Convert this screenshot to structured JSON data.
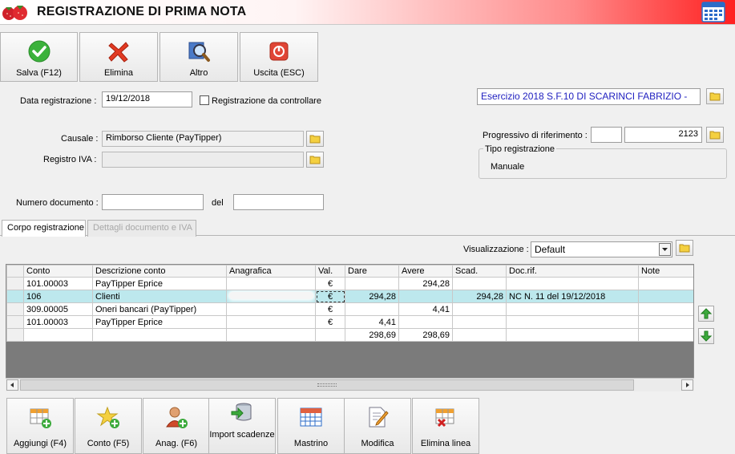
{
  "window": {
    "title": "REGISTRAZIONE DI PRIMA NOTA"
  },
  "toolbar": {
    "save": "Salva (F12)",
    "delete": "Elimina",
    "other": "Altro",
    "exit": "Uscita (ESC)"
  },
  "form": {
    "date_label": "Data registrazione :",
    "date_value": "19/12/2018",
    "check_label": "Registrazione da controllare",
    "causale_label": "Causale :",
    "causale_value": "Rimborso Cliente (PayTipper)",
    "registro_label": "Registro IVA :",
    "registro_value": "",
    "numdoc_label": "Numero documento :",
    "numdoc_value": "",
    "del_label": "del",
    "del_value": ""
  },
  "right_panel": {
    "esercizio": "Esercizio 2018 S.F.10 DI SCARINCI FABRIZIO -",
    "progressivo_label": "Progressivo di riferimento :",
    "progressivo_prefix": "",
    "progressivo_value": "2123",
    "tipo_title": "Tipo registrazione",
    "tipo_value": "Manuale"
  },
  "tabs": [
    {
      "label": "Corpo registrazione",
      "active": true
    },
    {
      "label": "Dettagli documento e IVA",
      "active": false
    }
  ],
  "visualizzazione": {
    "label": "Visualizzazione :",
    "value": "Default"
  },
  "grid": {
    "columns": [
      "Conto",
      "Descrizione conto",
      "Anagrafica",
      "Val.",
      "Dare",
      "Avere",
      "Scad.",
      "Doc.rif.",
      "Note"
    ],
    "rows": [
      {
        "conto": "101.00003",
        "descrizione": "PayTipper Eprice",
        "anagrafica": "",
        "val": "€",
        "dare": "",
        "avere": "294,28",
        "scad": "",
        "docrif": "",
        "note": ""
      },
      {
        "conto": "106",
        "descrizione": "Clienti",
        "anagrafica": "",
        "val": "€",
        "dare": "294,28",
        "avere": "",
        "scad": "294,28",
        "docrif": "NC N. 11 del 19/12/2018",
        "note": ""
      },
      {
        "conto": "309.00005",
        "descrizione": "Oneri bancari (PayTipper)",
        "anagrafica": "",
        "val": "€",
        "dare": "",
        "avere": "4,41",
        "scad": "",
        "docrif": "",
        "note": ""
      },
      {
        "conto": "101.00003",
        "descrizione": "PayTipper Eprice",
        "anagrafica": "",
        "val": "€",
        "dare": "4,41",
        "avere": "",
        "scad": "",
        "docrif": "",
        "note": ""
      }
    ],
    "totals": {
      "dare": "298,69",
      "avere": "298,69"
    }
  },
  "bottom_toolbar": {
    "add": "Aggiungi (F4)",
    "conto": "Conto (F5)",
    "anag": "Anag. (F6)",
    "import": "Import scadenze",
    "mastrino": "Mastrino",
    "modifica": "Modifica",
    "elimina_linea": "Elimina linea"
  },
  "colors": {
    "selected_row": "#bde8ed",
    "accent_red": "#ff2020",
    "esercizio_text": "#2020c0"
  },
  "icons": [
    "strawberry-icon",
    "calendar-icon",
    "check-icon",
    "x-icon",
    "search-icon",
    "power-icon",
    "folder-icon",
    "arrow-up-icon",
    "arrow-down-icon",
    "table-add-icon",
    "star-add-icon",
    "person-add-icon",
    "database-import-icon",
    "calendar-grid-icon",
    "edit-icon",
    "table-delete-icon"
  ]
}
